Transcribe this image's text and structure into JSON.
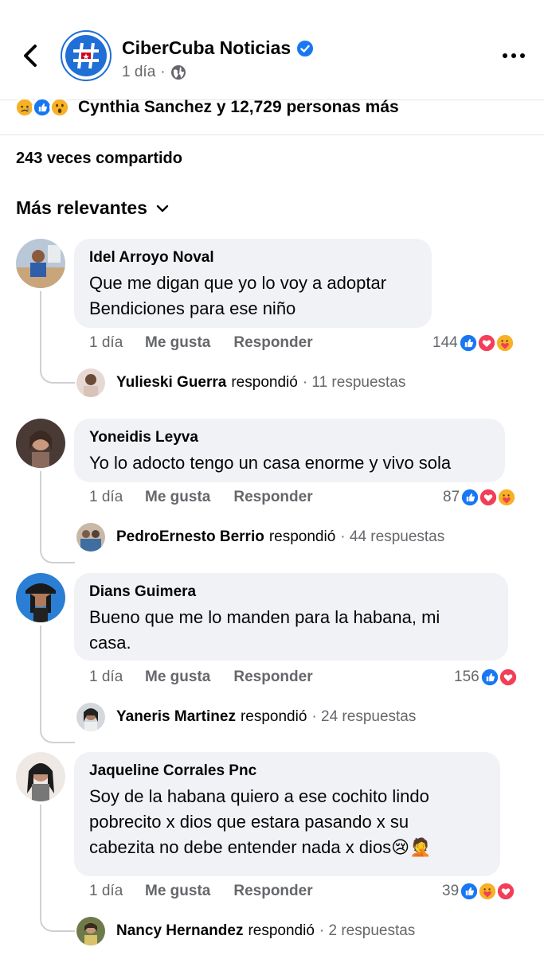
{
  "header": {
    "page_name": "CiberCuba Noticias",
    "time": "1 día",
    "separator": "·"
  },
  "reactions": {
    "icons": [
      "sad-icon",
      "like-icon",
      "wow-icon"
    ],
    "summary": "Cynthia Sanchez y 12,729 personas más"
  },
  "shares": "243 veces compartido",
  "sort": {
    "label": "Más relevantes"
  },
  "actions": {
    "like_label": "Me gusta",
    "reply_label": "Responder"
  },
  "comments": [
    {
      "author": "Idel Arroyo Noval",
      "text": "Que me digan que yo lo voy a adoptar\nBendiciones para ese niño",
      "time": "1 día",
      "reaction_count": "144",
      "reaction_icons": [
        "like-icon",
        "love-icon",
        "care-icon"
      ],
      "reply": {
        "name": "Yulieski Guerra",
        "verb": "respondió",
        "count": "· 11 respuestas"
      }
    },
    {
      "author": "Yoneidis Leyva",
      "text": "Yo lo adocto tengo un casa enorme y vivo sola",
      "time": "1 día",
      "reaction_count": "87",
      "reaction_icons": [
        "like-icon",
        "love-icon",
        "care-icon"
      ],
      "reply": {
        "name": "PedroErnesto Berrio",
        "verb": "respondió",
        "count": "· 44 respuestas"
      }
    },
    {
      "author": "Dians Guimera",
      "text": "Bueno que me lo manden para la habana, mi\ncasa.",
      "time": "1 día",
      "reaction_count": "156",
      "reaction_icons": [
        "like-icon",
        "love-icon"
      ],
      "reply": {
        "name": "Yaneris Martinez",
        "verb": "respondió",
        "count": "· 24 respuestas"
      }
    },
    {
      "author": "Jaqueline Corrales Pnc",
      "text": "Soy de la habana  quiero a  ese cochito lindo\npobrecito  x dios que estara pasando x su\ncabezita  no debe  entender nada x dios😢🤦",
      "time": "1 día",
      "reaction_count": "39",
      "reaction_icons": [
        "like-icon",
        "care-icon",
        "love-icon"
      ],
      "reply": {
        "name": "Nancy Hernandez",
        "verb": "respondió",
        "count": "· 2 respuestas"
      }
    }
  ],
  "colors": {
    "facebook_blue": "#1877f2",
    "love_red": "#f33e58",
    "care_yellow": "#f7b125",
    "bubble_bg": "#f0f2f5",
    "secondary_text": "#65676b"
  }
}
